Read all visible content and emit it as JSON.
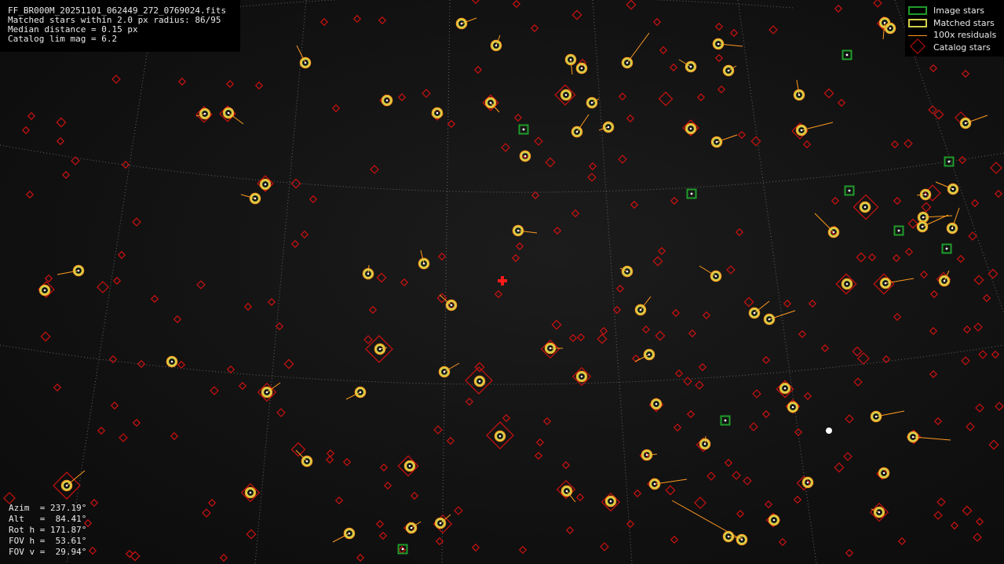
{
  "header": {
    "filename": "FF_BR000M_20251101_062449_272_0769024.fits",
    "matched": "Matched stars within 2.0 px radius: 86/95",
    "median": "Median distance = 0.15 px",
    "limmag": "Catalog lim mag = 6.2"
  },
  "legend": {
    "image_stars": "Image stars",
    "matched_stars": "Matched stars",
    "residuals": "100x residuals",
    "catalog_stars": "Catalog stars"
  },
  "pointing": {
    "azim": "Azim  = 237.19°",
    "alt": "Alt   =  84.41°",
    "rot": "Rot h = 171.87°",
    "fovh": "FOV h =  53.61°",
    "fovv": "FOV v =  29.94°"
  },
  "colors": {
    "image_star": "#1f9c2a",
    "matched_star": "#d4d04a",
    "residual": "#ff9a20",
    "catalog_star": "#cc1111",
    "center_cross": "#ff1a1a",
    "grid": "#7a7a7a"
  },
  "icons": {
    "center": "red-cross-icon"
  }
}
